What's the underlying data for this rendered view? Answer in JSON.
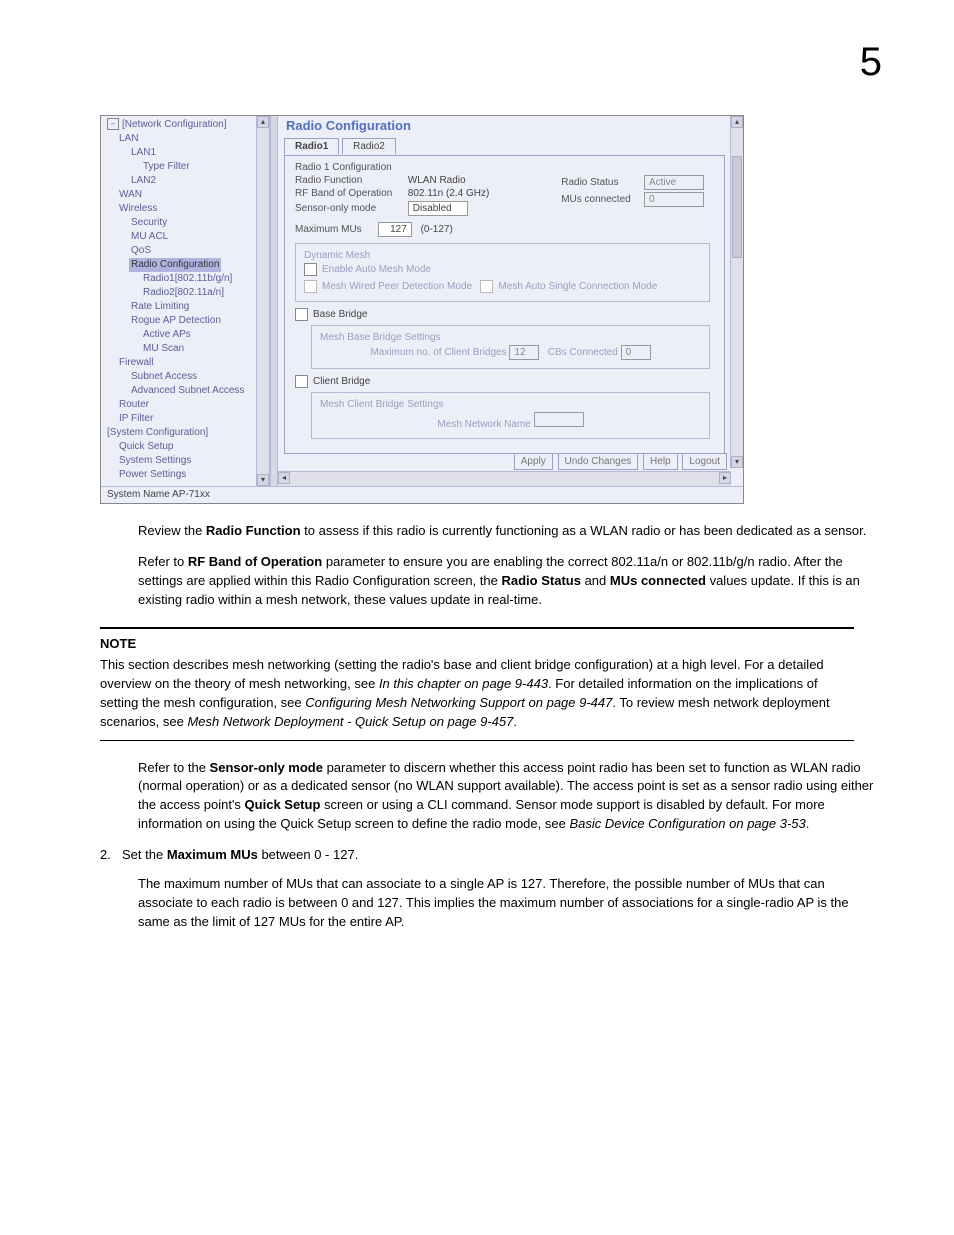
{
  "pageNumber": "5",
  "screenshot": {
    "title": "Radio Configuration",
    "statusBar": "System Name AP-71xx",
    "nav": {
      "root": "[Network Configuration]",
      "items": [
        {
          "label": "LAN",
          "indent": 1
        },
        {
          "label": "LAN1",
          "indent": 2
        },
        {
          "label": "Type Filter",
          "indent": 3
        },
        {
          "label": "LAN2",
          "indent": 2
        },
        {
          "label": "WAN",
          "indent": 1
        },
        {
          "label": "Wireless",
          "indent": 1
        },
        {
          "label": "Security",
          "indent": 2
        },
        {
          "label": "MU ACL",
          "indent": 2
        },
        {
          "label": "QoS",
          "indent": 2
        },
        {
          "label": "Radio Configuration",
          "indent": 2,
          "selected": true
        },
        {
          "label": "Radio1[802.11b/g/n]",
          "indent": 3
        },
        {
          "label": "Radio2[802.11a/n]",
          "indent": 3
        },
        {
          "label": "Rate Limiting",
          "indent": 2
        },
        {
          "label": "Rogue AP Detection",
          "indent": 2
        },
        {
          "label": "Active APs",
          "indent": 3
        },
        {
          "label": "MU Scan",
          "indent": 3
        },
        {
          "label": "Firewall",
          "indent": 1
        },
        {
          "label": "Subnet Access",
          "indent": 2
        },
        {
          "label": "Advanced Subnet Access",
          "indent": 2
        },
        {
          "label": "Router",
          "indent": 1
        },
        {
          "label": "IP Filter",
          "indent": 1
        },
        {
          "label": "[System Configuration]",
          "indent": 0
        },
        {
          "label": "Quick Setup",
          "indent": 1
        },
        {
          "label": "System Settings",
          "indent": 1
        },
        {
          "label": "Power Settings",
          "indent": 1
        }
      ]
    },
    "tabs": {
      "tab1": "Radio1",
      "tab2": "Radio2"
    },
    "radio1": {
      "legend": "Radio 1 Configuration",
      "radioFunctionLabel": "Radio Function",
      "radioFunctionValue": "WLAN Radio",
      "rfBandLabel": "RF Band of Operation",
      "rfBandValue": "802.11n (2.4 GHz)",
      "sensorLabel": "Sensor-only mode",
      "sensorValue": "Disabled",
      "radioStatusLabel": "Radio Status",
      "radioStatusValue": "Active",
      "musConnLabel": "MUs connected",
      "musConnValue": "0",
      "maxMusLabel": "Maximum MUs",
      "maxMusValue": "127",
      "maxMusRange": "(0-127)"
    },
    "dynMesh": {
      "legend": "Dynamic Mesh",
      "enable": "Enable Auto Mesh Mode",
      "peer": "Mesh Wired Peer Detection Mode",
      "single": "Mesh Auto Single Connection Mode"
    },
    "baseBridge": {
      "label": "Base Bridge",
      "legend": "Mesh Base Bridge Settings",
      "maxCbLabel": "Maximum no. of Client Bridges",
      "maxCbValue": "12",
      "cbsConnLabel": "CBs Connected",
      "cbsConnValue": "0"
    },
    "clientBridge": {
      "label": "Client Bridge",
      "legend": "Mesh Client Bridge Settings",
      "nameLabel": "Mesh Network Name"
    },
    "buttons": {
      "apply": "Apply",
      "undo": "Undo Changes",
      "help": "Help",
      "logout": "Logout"
    }
  },
  "para1": {
    "pre": "Review the ",
    "b": "Radio Function",
    "post": " to assess if this radio is currently functioning as a WLAN radio or has been dedicated as a sensor."
  },
  "para2": {
    "t1": "Refer to ",
    "b1": "RF Band of Operation",
    "t2": " parameter to ensure you are enabling the correct 802.11a/n or 802.11b/g/n radio. After the settings are applied within this Radio Configuration screen, the ",
    "b2": "Radio Status",
    "t3": " and ",
    "b3": "MUs connected",
    "t4": " values update. If this is an existing radio within a mesh network, these values update in real-time."
  },
  "note": {
    "title": "NOTE",
    "t1": "This section describes mesh networking (setting the radio's base and client bridge configuration) at a high level. For a detailed overview on the theory of mesh networking, see ",
    "i1": "In this chapter on page 9-443",
    "t2": ". For detailed information on the implications of setting the mesh configuration, see ",
    "i2": "Configuring Mesh Networking Support on page 9-447",
    "t3": ". To review mesh network deployment scenarios, see ",
    "i3": "Mesh Network Deployment - Quick Setup on page 9-457",
    "t4": "."
  },
  "para3": {
    "t1": "Refer to the ",
    "b1": "Sensor-only mode",
    "t2": " parameter to discern whether this access point radio has been set to function as WLAN radio (normal operation) or as a dedicated sensor (no WLAN support available). The access point is set as a sensor radio using either the access point's ",
    "b2": "Quick Setup",
    "t3": " screen or using a CLI command. Sensor mode support is disabled by default. For more information on using the Quick Setup screen to define the radio mode, see ",
    "i1": "Basic Device Configuration on page 3-53",
    "t4": "."
  },
  "step2": {
    "num": "2.",
    "t1": "Set the ",
    "b1": "Maximum MUs",
    "t2": " between 0 - 127."
  },
  "step2sub": "The maximum number of MUs that can associate to a single AP is 127. Therefore, the possible number of MUs that can associate to each radio is between 0 and 127. This implies the maximum number of associations for a single-radio AP is the same as the limit of 127 MUs for the entire AP."
}
